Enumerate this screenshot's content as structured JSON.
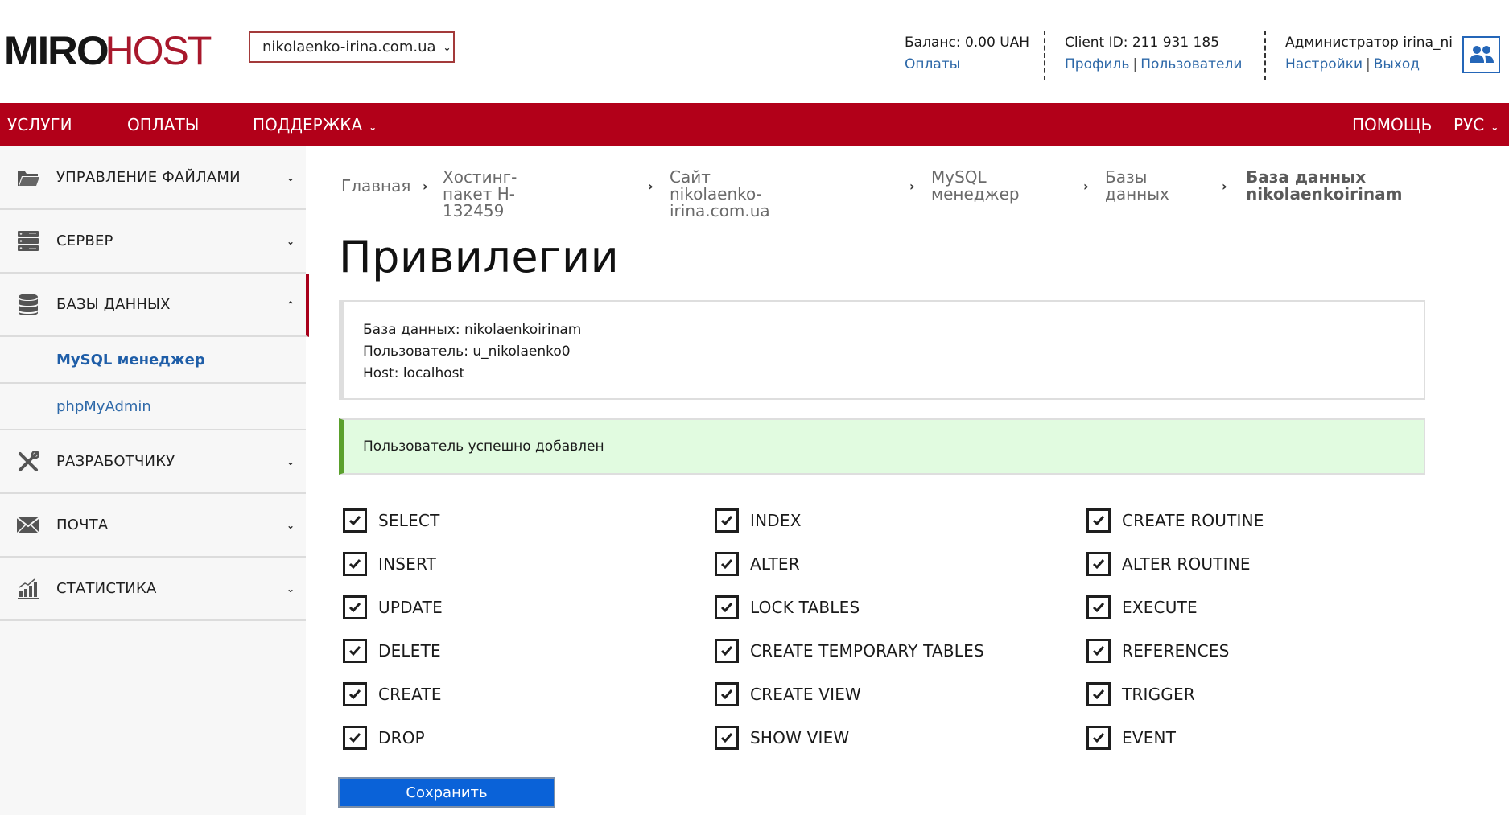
{
  "header": {
    "logo": {
      "part1": "MIRO",
      "part2": "HOST"
    },
    "site_select": {
      "value": "nikolaenko-irina.com.ua"
    },
    "balance": {
      "text": "Баланс: 0.00 UAH",
      "payments_link": "Оплаты"
    },
    "client": {
      "text": "Client ID: 211 931 185",
      "profile_link": "Профиль",
      "separator": "|",
      "users_link": "Пользователи"
    },
    "admin": {
      "text": "Администратор irina_ni",
      "settings_link": "Настройки",
      "separator": "|",
      "logout_link": "Выход"
    },
    "users_icon": "users-icon"
  },
  "topnav": {
    "items": [
      {
        "label": "УСЛУГИ"
      },
      {
        "label": "ОПЛАТЫ"
      },
      {
        "label": "ПОДДЕРЖКА",
        "has_dropdown": true
      }
    ],
    "right": [
      {
        "label": "ПОМОЩЬ"
      },
      {
        "label": "РУС",
        "has_dropdown": true
      }
    ]
  },
  "sidebar": {
    "items": [
      {
        "label": "УПРАВЛЕНИЕ ФАЙЛАМИ",
        "icon": "folder-icon",
        "expanded": false
      },
      {
        "label": "СЕРВЕР",
        "icon": "server-icon",
        "expanded": false
      },
      {
        "label": "БАЗЫ ДАННЫХ",
        "icon": "database-icon",
        "expanded": true,
        "children": [
          {
            "label": "MySQL менеджер",
            "current": true
          },
          {
            "label": "phpMyAdmin",
            "current": false
          }
        ]
      },
      {
        "label": "РАЗРАБОТЧИКУ",
        "icon": "tools-icon",
        "expanded": false
      },
      {
        "label": "ПОЧТА",
        "icon": "mail-icon",
        "expanded": false
      },
      {
        "label": "СТАТИСТИКА",
        "icon": "stats-icon",
        "expanded": false
      }
    ]
  },
  "breadcrumb": [
    {
      "line1": "Главная",
      "line2": ""
    },
    {
      "line1": "Хостинг-пакет H-",
      "line2": "132459"
    },
    {
      "line1": "Сайт nikolaenko-",
      "line2": "irina.com.ua"
    },
    {
      "line1": "MySQL",
      "line2": "менеджер"
    },
    {
      "line1": "Базы",
      "line2": "данных"
    },
    {
      "line1": "База данных",
      "line2": "nikolaenkoirinam",
      "current": true
    }
  ],
  "page": {
    "title": "Привилегии",
    "info": {
      "database": "База данных: nikolaenkoirinam",
      "user": "Пользователь: u_nikolaenko0",
      "host": "Host: localhost"
    },
    "success_message": "Пользователь успешно добавлен",
    "privileges": {
      "columns": [
        [
          {
            "label": "SELECT",
            "checked": true
          },
          {
            "label": "INSERT",
            "checked": true
          },
          {
            "label": "UPDATE",
            "checked": true
          },
          {
            "label": "DELETE",
            "checked": true
          },
          {
            "label": "CREATE",
            "checked": true
          },
          {
            "label": "DROP",
            "checked": true
          }
        ],
        [
          {
            "label": "INDEX",
            "checked": true
          },
          {
            "label": "ALTER",
            "checked": true
          },
          {
            "label": "LOCK TABLES",
            "checked": true
          },
          {
            "label": "CREATE TEMPORARY TABLES",
            "checked": true
          },
          {
            "label": "CREATE VIEW",
            "checked": true
          },
          {
            "label": "SHOW VIEW",
            "checked": true
          }
        ],
        [
          {
            "label": "CREATE ROUTINE",
            "checked": true
          },
          {
            "label": "ALTER ROUTINE",
            "checked": true
          },
          {
            "label": "EXECUTE",
            "checked": true
          },
          {
            "label": "REFERENCES",
            "checked": true
          },
          {
            "label": "TRIGGER",
            "checked": true
          },
          {
            "label": "EVENT",
            "checked": true
          }
        ]
      ]
    },
    "save_label": "Сохранить"
  },
  "colors": {
    "brand_red": "#b20019",
    "link_blue": "#2d68a8",
    "button_blue": "#0a62d8",
    "success_bg": "#e1fbe0",
    "success_border": "#5aa02c"
  }
}
